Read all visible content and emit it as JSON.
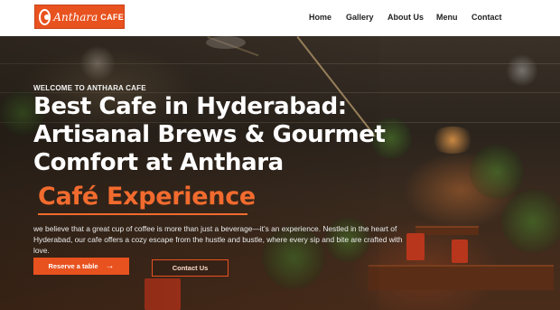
{
  "brand": {
    "logo_script": "Anthara",
    "logo_word": "CAFE"
  },
  "nav": {
    "items": [
      {
        "label": "Home"
      },
      {
        "label": "Gallery"
      },
      {
        "label": "About Us"
      },
      {
        "label": "Menu"
      },
      {
        "label": "Contact"
      }
    ]
  },
  "hero": {
    "eyebrow": "WELCOME TO ANTHARA CAFE",
    "headline_lines": [
      "Best Cafe in Hyderabad:",
      "Artisanal Brews & Gourmet",
      "Comfort at Anthara"
    ],
    "accent": "Café Experience",
    "description": "we believe that a great cup of coffee is more than just a beverage—it's an experience. Nestled in the heart of Hyderabad, our cafe offers a cozy escape from the hustle and bustle, where every sip and bite are crafted with love.",
    "primary_button": "Reserve a table",
    "primary_button_icon": "→",
    "secondary_button": "Contact Us"
  },
  "colors": {
    "accent": "#e8521f",
    "accent_text": "#f26b2e",
    "nav_bg": "#ffffff"
  }
}
